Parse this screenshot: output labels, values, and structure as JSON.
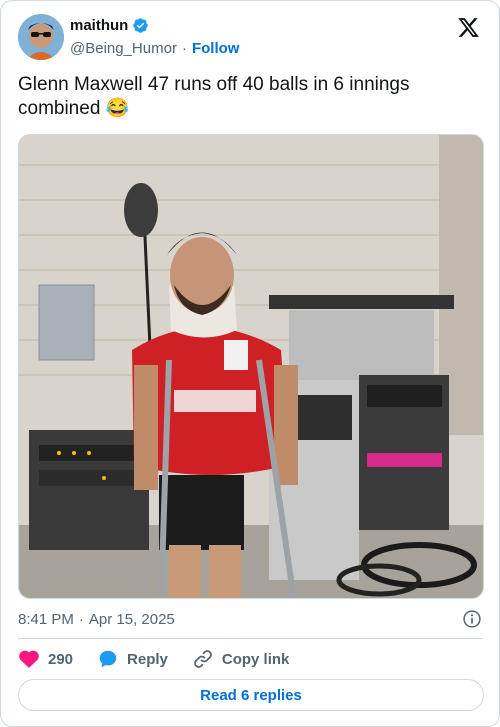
{
  "author": {
    "display_name": "maithun",
    "handle": "@Being_Humor",
    "separator": "·",
    "follow_label": "Follow",
    "verified_color": "#1d9bf0"
  },
  "tweet": {
    "text": "Glenn Maxwell 47 runs off 40 balls in 6 innings combined 😂",
    "image_icon": "photo-of-player-on-crutches-with-neck-brace"
  },
  "meta": {
    "time": "8:41 PM",
    "separator": "·",
    "date": "Apr 15, 2025"
  },
  "actions": {
    "like_count": "290",
    "reply_label": "Reply",
    "copy_link_label": "Copy link"
  },
  "replies_button_label": "Read 6 replies",
  "colors": {
    "accent": "#006fd6",
    "like": "#f91880",
    "reply_blue": "#1d9bf0",
    "muted": "#536471",
    "border": "#cfd9de"
  }
}
